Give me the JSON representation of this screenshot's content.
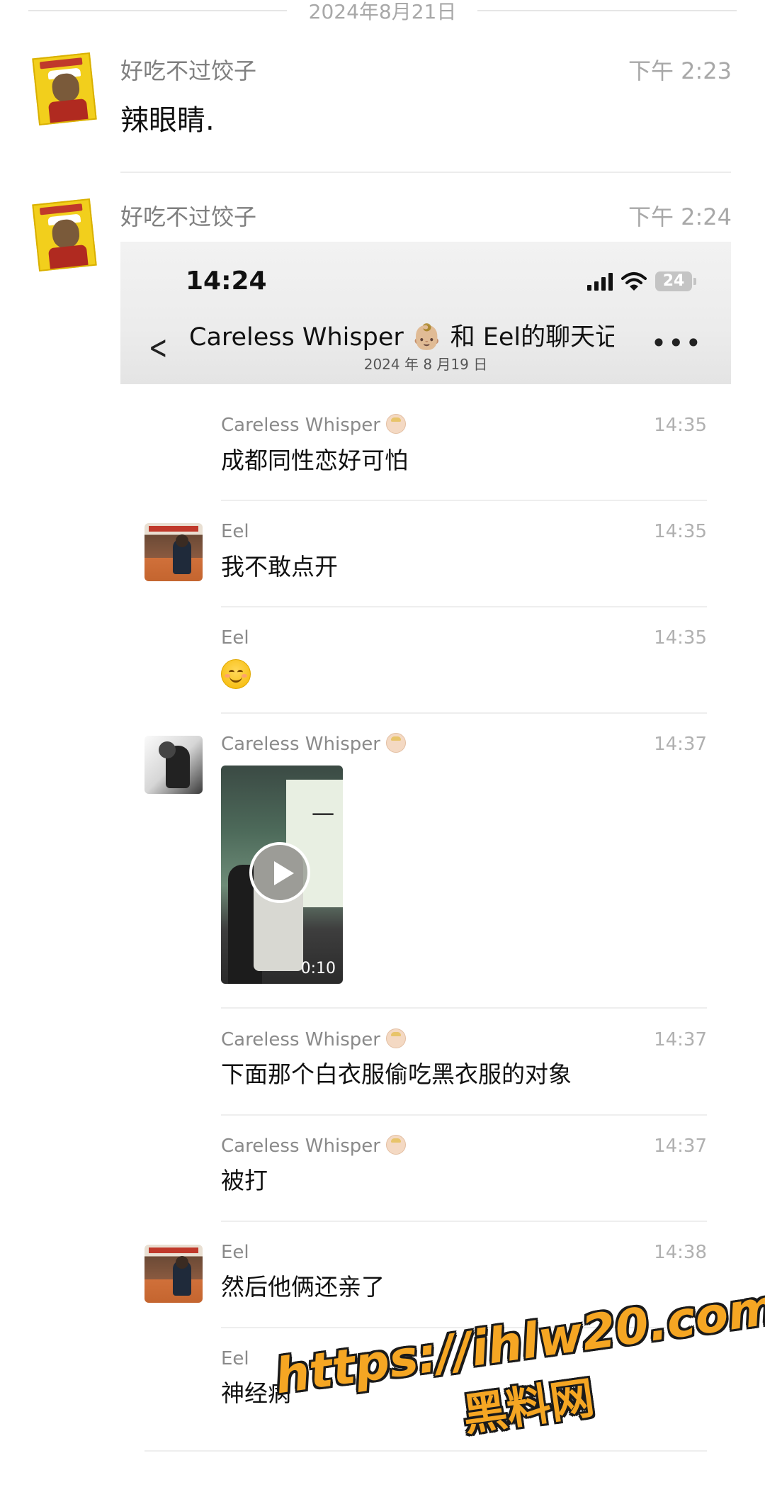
{
  "history": {
    "date": "2024年8月21日",
    "messages": [
      {
        "sender": "好吃不过饺子",
        "time": "下午 2:23",
        "text": "辣眼睛."
      },
      {
        "sender": "好吃不过饺子",
        "time": "下午 2:24"
      }
    ]
  },
  "screenshot": {
    "status_time": "14:24",
    "battery": "24",
    "title": "Careless  Whisper 👶🏼 和 Eel的聊天记录",
    "subtitle": "2024 年 8 月19 日",
    "back_icon": "chevron-left-icon",
    "more_icon": "more-dots-icon",
    "more_label": "•••",
    "messages": [
      {
        "sender": "Careless  Whisper",
        "time": "14:35",
        "text": "成都同性恋好可怕"
      },
      {
        "sender": "Eel",
        "time": "14:35",
        "text": "我不敢点开"
      },
      {
        "sender": "Eel",
        "time": "14:35",
        "emoji": "smiling-face-icon"
      },
      {
        "sender": "Careless  Whisper",
        "time": "14:37",
        "video_duration": "0:10"
      },
      {
        "sender": "Careless  Whisper",
        "time": "14:37",
        "text": "下面那个白衣服偷吃黑衣服的对象"
      },
      {
        "sender": "Careless  Whisper",
        "time": "14:37",
        "text": "被打"
      },
      {
        "sender": "Eel",
        "time": "14:38",
        "text": "然后他俩还亲了"
      },
      {
        "sender": "Eel",
        "text": "神经病"
      }
    ]
  },
  "watermark": {
    "url": "https://ihlw20.com",
    "name": "黑料网",
    "color": "#f5a623"
  }
}
